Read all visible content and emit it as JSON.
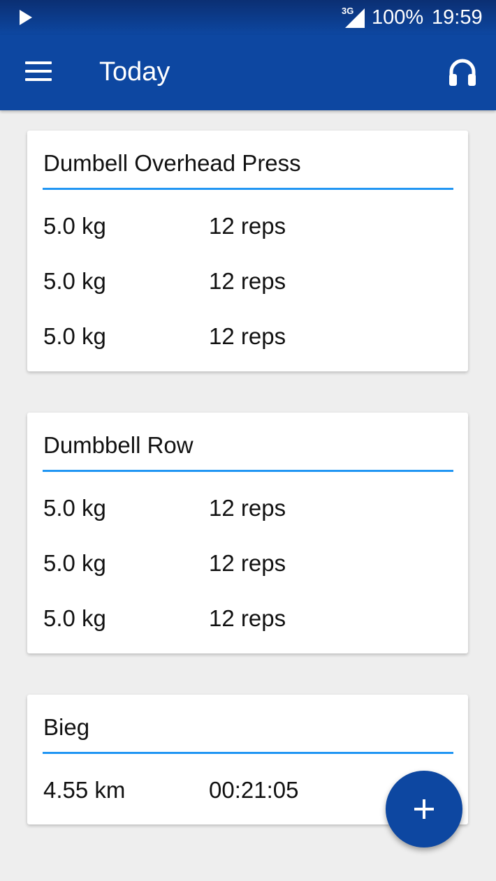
{
  "status_bar": {
    "network": "3G",
    "battery": "100%",
    "time": "19:59"
  },
  "app_bar": {
    "title": "Today"
  },
  "workouts": [
    {
      "title": "Dumbell Overhead Press",
      "rows": [
        {
          "a": "5.0 kg",
          "b": "12 reps"
        },
        {
          "a": "5.0 kg",
          "b": "12 reps"
        },
        {
          "a": "5.0 kg",
          "b": "12 reps"
        }
      ]
    },
    {
      "title": "Dumbbell Row",
      "rows": [
        {
          "a": "5.0 kg",
          "b": "12 reps"
        },
        {
          "a": "5.0 kg",
          "b": "12 reps"
        },
        {
          "a": "5.0 kg",
          "b": "12 reps"
        }
      ]
    },
    {
      "title": "Bieg",
      "rows": [
        {
          "a": "4.55 km",
          "b": "00:21:05"
        }
      ]
    }
  ],
  "colors": {
    "primary": "#0d47a1",
    "accent_line": "#2196f3",
    "background": "#eeeeee"
  },
  "icons": {
    "menu": "hamburger-menu-icon",
    "headset": "headset-icon",
    "add": "plus-icon",
    "play": "play-icon",
    "signal": "signal-icon"
  }
}
